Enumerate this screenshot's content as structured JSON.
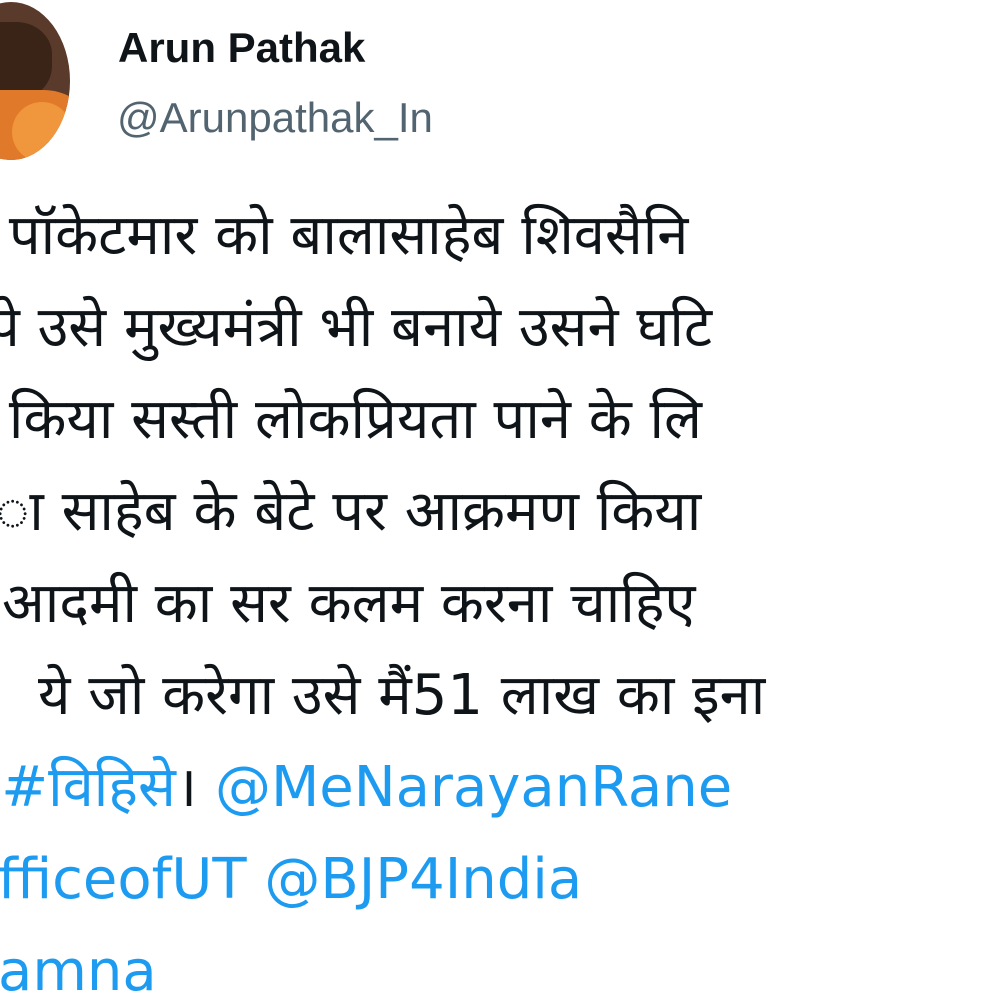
{
  "tweet": {
    "author": {
      "display_name": "Arun Pathak",
      "handle": "@Arunpathak_In"
    },
    "lines": [
      {
        "text": "r पॉकेटमार को बालासाहेब शिवसैनि"
      },
      {
        "text": "पे उसे मुख्यमंत्री भी बनाये उसने घटि"
      },
      {
        "text": "r किया सस्ती लोकप्रियता पाने के लि"
      },
      {
        "text": "ा साहेब के बेटे पर आक्रमण किया"
      },
      {
        "text": "आदमी का सर कलम करना चाहिए"
      },
      {
        "text": "ये जो करेगा उसे मैं51 लाख का इना"
      }
    ],
    "hashtag_line": {
      "prefix": "।",
      "hashtag": "#विहिसे",
      "separator": "।",
      "mention": "@MeNarayanRane"
    },
    "mention_line": {
      "mention1": "fficeofUT",
      "mention2": "@BJP4India"
    },
    "last_line": {
      "mention": "amna"
    }
  }
}
